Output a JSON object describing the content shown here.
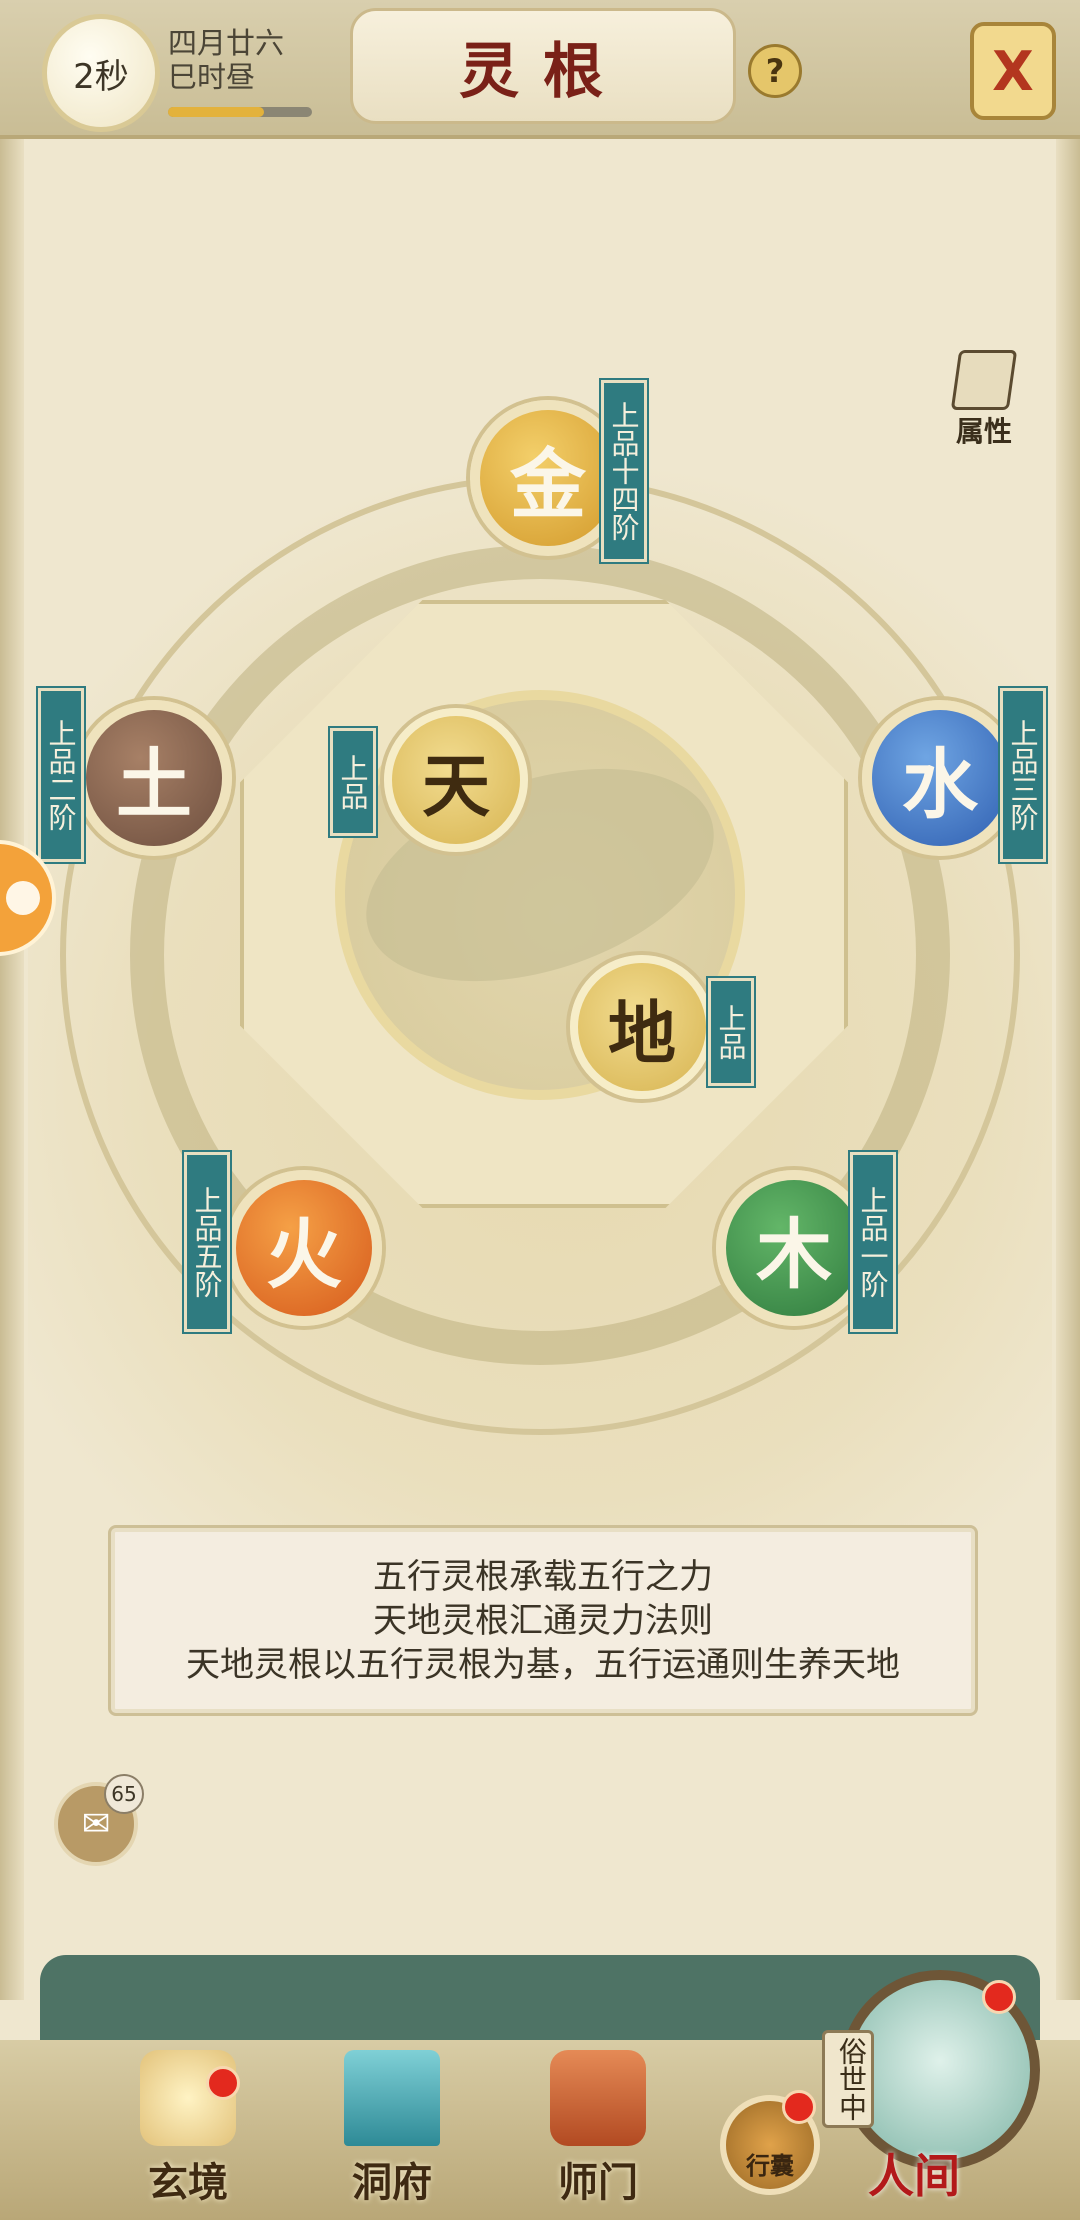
{
  "header": {
    "timer": "2秒",
    "date_line1": "四月廿六",
    "date_line2": "巳时昼",
    "progress": 0.67,
    "title": "灵根",
    "help_symbol": "?",
    "close_symbol": "X"
  },
  "attribute_button": {
    "label": "属性"
  },
  "elements": {
    "metal": {
      "char": "金",
      "rank": "上品十四阶"
    },
    "earth": {
      "char": "土",
      "rank": "上品二阶"
    },
    "water": {
      "char": "水",
      "rank": "上品三阶"
    },
    "fire": {
      "char": "火",
      "rank": "上品五阶"
    },
    "wood": {
      "char": "木",
      "rank": "上品一阶"
    },
    "heaven": {
      "char": "天",
      "rank": "上品"
    },
    "ground": {
      "char": "地",
      "rank": "上品"
    }
  },
  "description": {
    "line1": "五行灵根承载五行之力",
    "line2": "天地灵根汇通灵力法则",
    "line3": "天地灵根以五行灵根为基，五行运通则生养天地"
  },
  "chat": {
    "badge": "65"
  },
  "nav": {
    "xuanjing": "玄境",
    "dongfu": "洞府",
    "shimen": "师门",
    "xingnang": "行囊",
    "sushizhong": "俗世中",
    "renjian": "人间"
  },
  "colors": {
    "rank_tag": "#2f7b80",
    "title_red": "#7a2118",
    "metal": "#d39a2b",
    "earth": "#6e4f3f",
    "water": "#2f5fb1",
    "fire": "#d65a1c",
    "wood": "#2f7a3e"
  }
}
